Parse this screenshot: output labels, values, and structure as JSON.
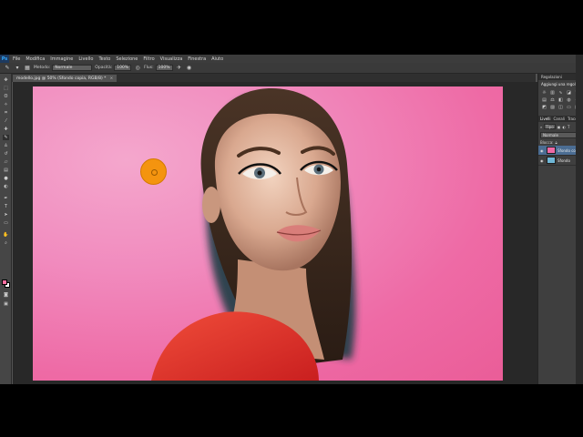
{
  "app": {
    "logo": "Ps",
    "menu": [
      "File",
      "Modifica",
      "Immagine",
      "Livello",
      "Testo",
      "Selezione",
      "Filtro",
      "Visualizza",
      "Finestra",
      "Aiuto"
    ]
  },
  "options": {
    "mode_label": "Metodo:",
    "mode_value": "Normale",
    "opacity_label": "Opacità:",
    "opacity_value": "100%",
    "flow_label": "Flus:",
    "flow_value": "100%"
  },
  "document": {
    "tab_title": "modello.jpg @ 50% (Sfondo copia, RGB/8) *",
    "close": "×"
  },
  "colors": {
    "foreground": "#ff6fa0",
    "background": "#ffffff",
    "canvas_pink": "#ee6aa5",
    "brush_cursor": "#f4940f"
  },
  "tools": [
    "move-icon",
    "marquee-icon",
    "lasso-icon",
    "quick-select-icon",
    "crop-icon",
    "eyedropper-icon",
    "healing-icon",
    "brush-icon",
    "clone-stamp-icon",
    "history-brush-icon",
    "eraser-icon",
    "gradient-icon",
    "blur-icon",
    "dodge-icon",
    "pen-icon",
    "type-icon",
    "path-select-icon",
    "shape-icon",
    "hand-icon",
    "zoom-icon"
  ],
  "panels": {
    "adjustments_title": "Regolazioni",
    "adjustments_subtitle": "Aggiungi una regolaz.",
    "layer_tabs": [
      "Livelli",
      "Canali",
      "Tracciati"
    ],
    "filter_label": "Tipo",
    "blend_mode": "Normale",
    "lock_label": "Blocca:",
    "layers": [
      {
        "name": "Sfondo copia",
        "active": true
      },
      {
        "name": "Sfondo",
        "active": false
      }
    ]
  }
}
